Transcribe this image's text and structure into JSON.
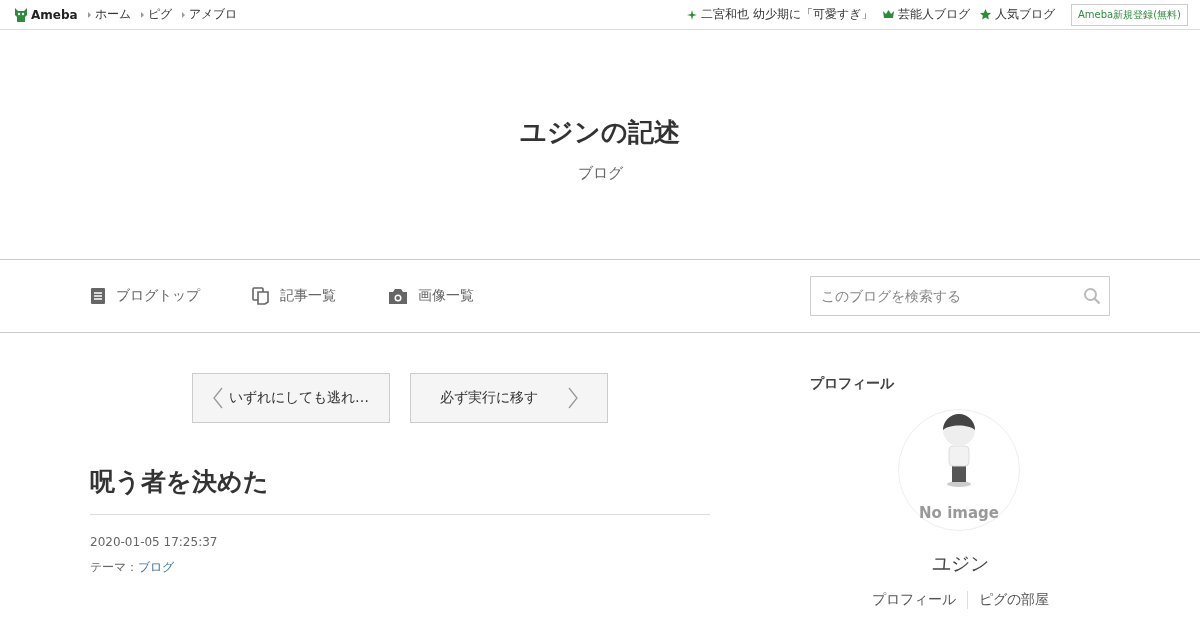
{
  "topbar": {
    "logo": "Ameba",
    "links": [
      "ホーム",
      "ピグ",
      "アメブロ"
    ],
    "right_links": [
      {
        "kind": "sparkle",
        "label": "二宮和也 幼少期に「可愛すぎ」"
      },
      {
        "kind": "crown",
        "label": "芸能人ブログ"
      },
      {
        "kind": "star",
        "label": "人気ブログ"
      }
    ],
    "register_button": "Ameba新規登録(無料)"
  },
  "header": {
    "title": "ユジンの記述",
    "subtitle": "ブログ"
  },
  "nav": {
    "items": [
      {
        "kind": "document",
        "label": "ブログトップ"
      },
      {
        "kind": "copy",
        "label": "記事一覧"
      },
      {
        "kind": "camera",
        "label": "画像一覧"
      }
    ],
    "search": {
      "placeholder": "このブログを検索する"
    }
  },
  "pager": {
    "prev": "いずれにしても逃れ…",
    "next": "必ず実行に移す"
  },
  "article": {
    "title": "呪う者を決めた",
    "date": "2020-01-05 17:25:37",
    "theme_label": "テーマ：",
    "theme": "ブログ"
  },
  "profile": {
    "heading": "プロフィール",
    "no_image": "No image",
    "name": "ユジン",
    "links": [
      "プロフィール",
      "ピグの部屋"
    ]
  }
}
